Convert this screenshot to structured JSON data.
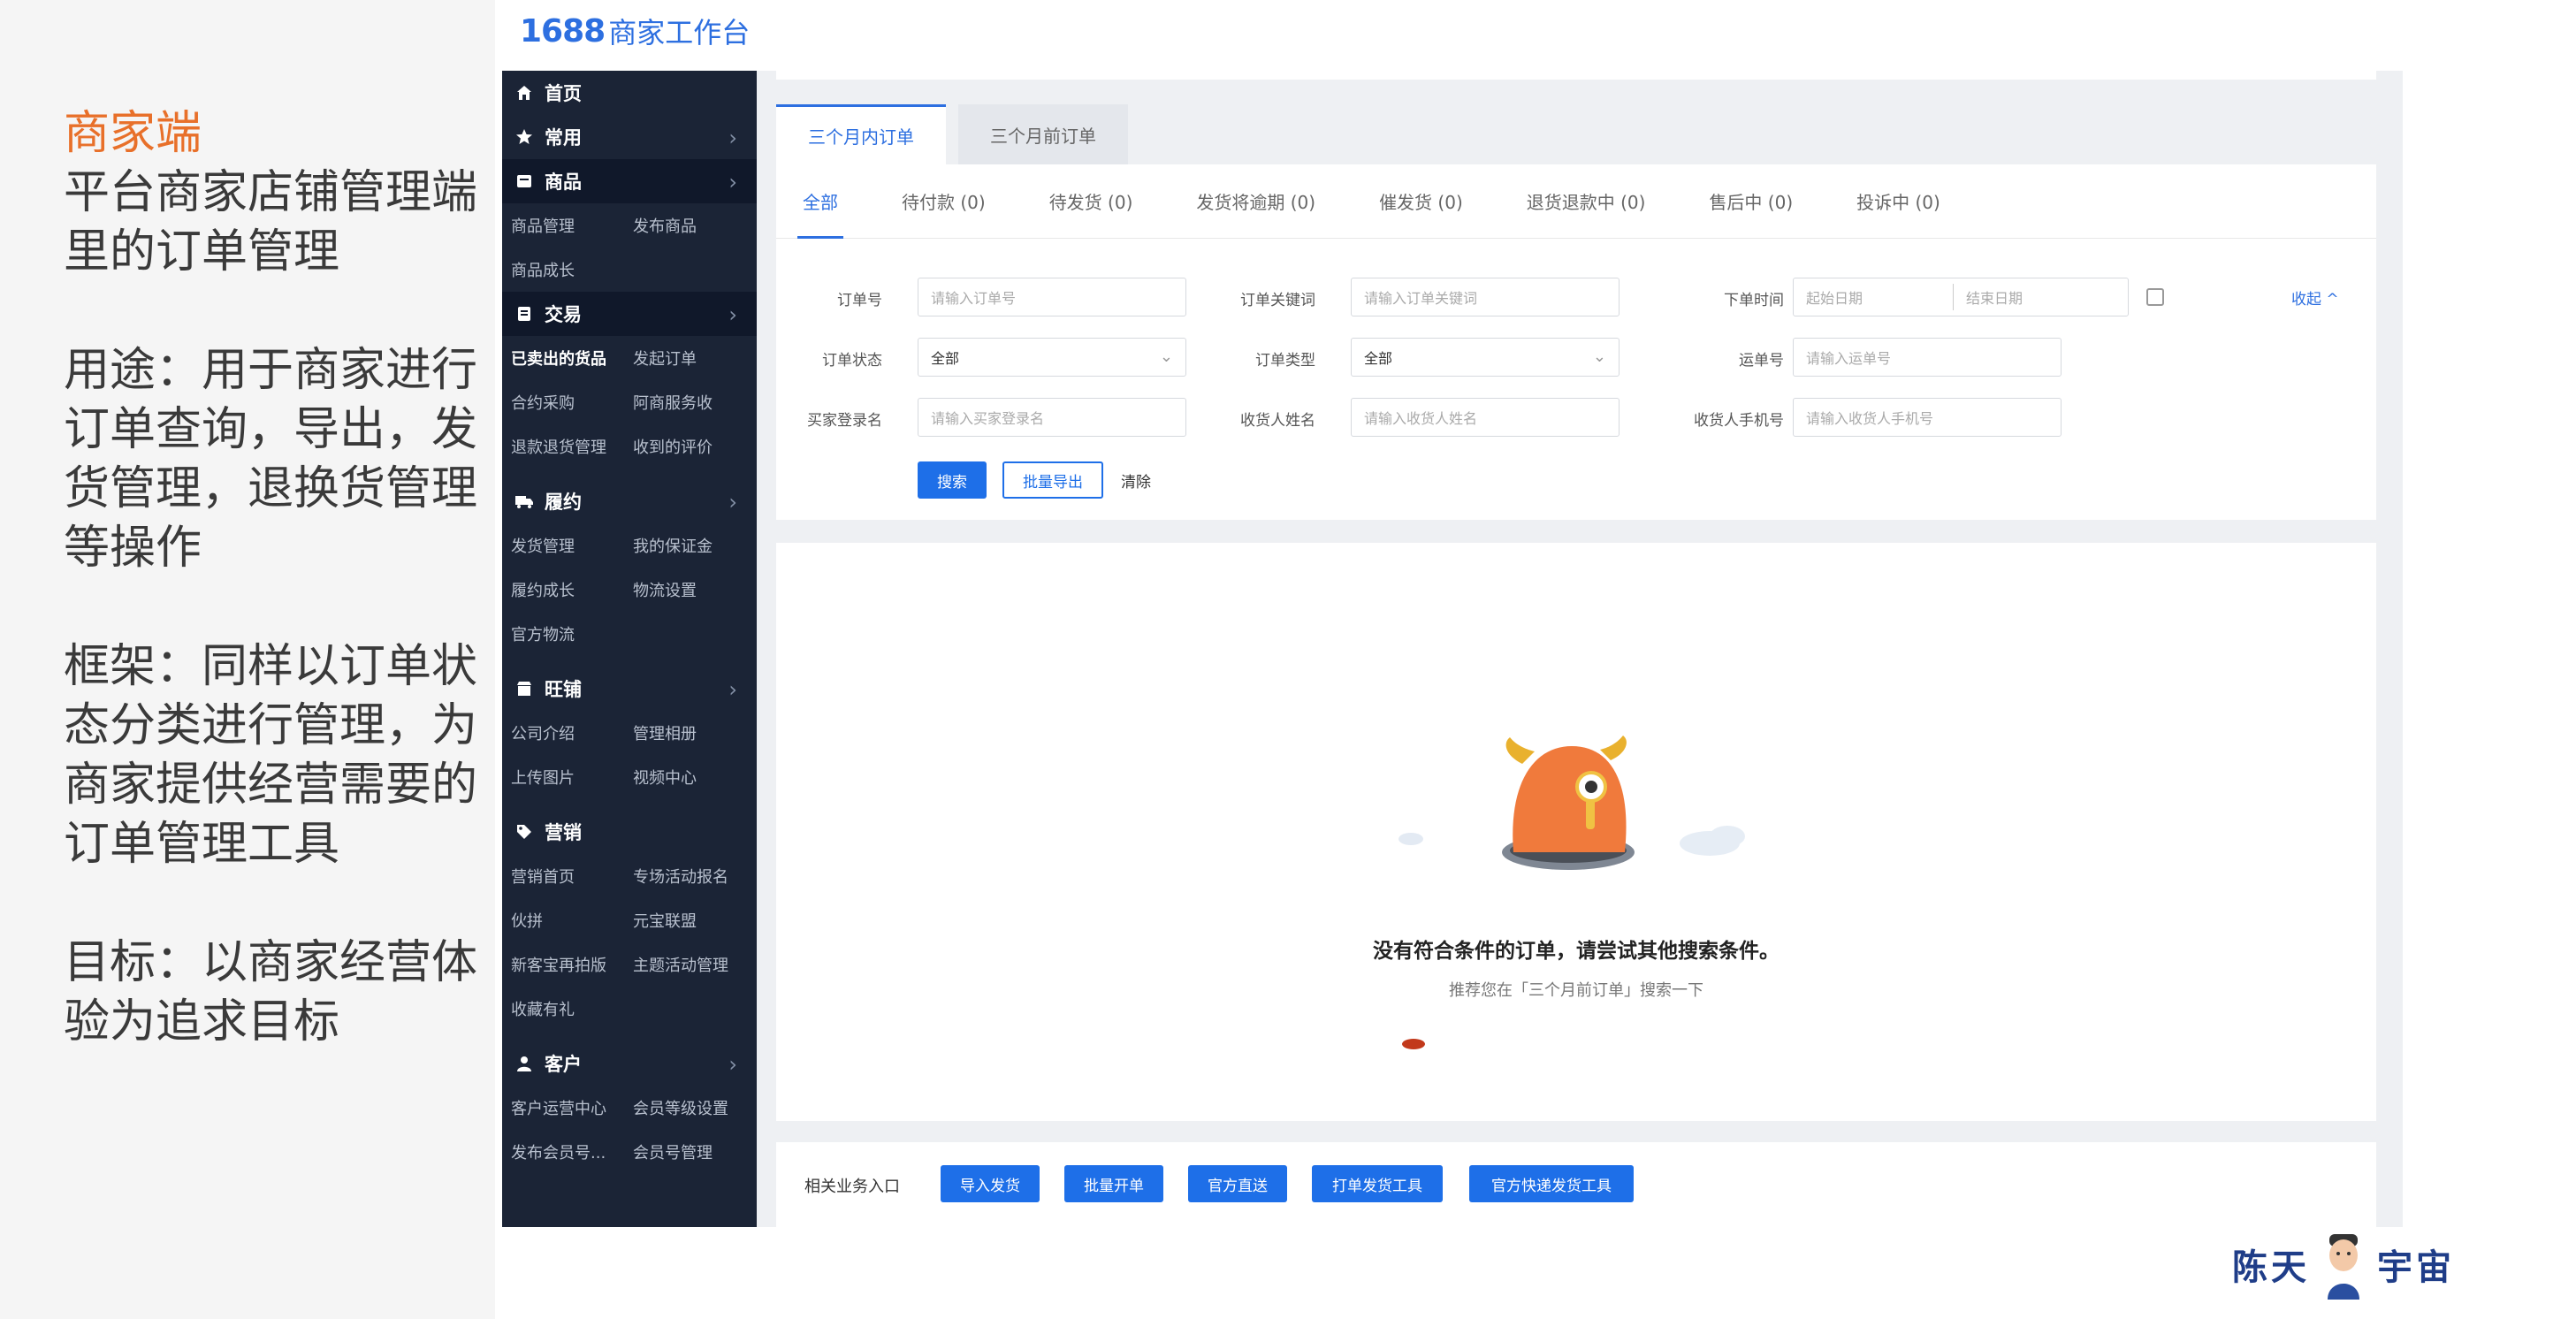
{
  "slide": {
    "heading": "商家端",
    "desc": "平台商家店铺管理端里的订单管理",
    "usage": "用途：用于商家进行订单查询，导出，发货管理，退换货管理等操作",
    "framework": "框架：同样以订单状态分类进行管理，为商家提供经营需要的订单管理工具",
    "goal": "目标：以商家经营体验为追求目标"
  },
  "brand": {
    "number": "1688",
    "name": "商家工作台"
  },
  "sidebar": {
    "home": "首页",
    "common": "常用",
    "product": {
      "title": "商品",
      "items": [
        "商品管理",
        "发布商品",
        "商品成长"
      ]
    },
    "trade": {
      "title": "交易",
      "items": [
        "已卖出的货品",
        "发起订单",
        "合约采购",
        "阿商服务收",
        "退款退货管理",
        "收到的评价"
      ]
    },
    "fulfill": {
      "title": "履约",
      "items": [
        "发货管理",
        "我的保证金",
        "履约成长",
        "物流设置",
        "官方物流"
      ]
    },
    "shop": {
      "title": "旺铺",
      "items": [
        "公司介绍",
        "管理相册",
        "上传图片",
        "视频中心"
      ]
    },
    "marketing": {
      "title": "营销",
      "items": [
        "营销首页",
        "专场活动报名",
        "伙拼",
        "元宝联盟",
        "新客宝再拍版",
        "主题活动管理",
        "收藏有礼"
      ]
    },
    "customer": {
      "title": "客户",
      "items": [
        "客户运营中心",
        "会员等级设置",
        "发布会员号...",
        "会员号管理"
      ]
    }
  },
  "tabs": [
    "三个月内订单",
    "三个月前订单"
  ],
  "status_tabs": [
    "全部",
    "待付款 (0)",
    "待发货 (0)",
    "发货将逾期 (0)",
    "催发货 (0)",
    "退货退款中 (0)",
    "售后中 (0)",
    "投诉中 (0)"
  ],
  "filters": {
    "order_no": {
      "label": "订单号",
      "placeholder": "请输入订单号"
    },
    "keyword": {
      "label": "订单关键词",
      "placeholder": "请输入订单关键词"
    },
    "order_time": {
      "label": "下单时间",
      "start": "起始日期",
      "end": "结束日期"
    },
    "status": {
      "label": "订单状态",
      "value": "全部"
    },
    "type": {
      "label": "订单类型",
      "value": "全部"
    },
    "waybill": {
      "label": "运单号",
      "placeholder": "请输入运单号"
    },
    "buyer": {
      "label": "买家登录名",
      "placeholder": "请输入买家登录名"
    },
    "receiver": {
      "label": "收货人姓名",
      "placeholder": "请输入收货人姓名"
    },
    "phone": {
      "label": "收货人手机号",
      "placeholder": "请输入收货人手机号"
    },
    "collapse": "收起 ^"
  },
  "actions": {
    "search": "搜索",
    "export": "批量导出",
    "clear": "清除"
  },
  "empty": {
    "title": "没有符合条件的订单，请尝试其他搜索条件。",
    "subtitle": "推荐您在「三个月前订单」搜索一下"
  },
  "bottom": {
    "label": "相关业务入口",
    "buttons": [
      "导入发货",
      "批量开单",
      "官方直送",
      "打单发货工具",
      "官方快递发货工具"
    ]
  },
  "watermark": {
    "left": "陈天",
    "right": "宇宙"
  },
  "colors": {
    "accent": "#1e6fe8",
    "sidebar": "#1b2436",
    "heading": "#e8702a",
    "mascot": "#f07a3c"
  }
}
